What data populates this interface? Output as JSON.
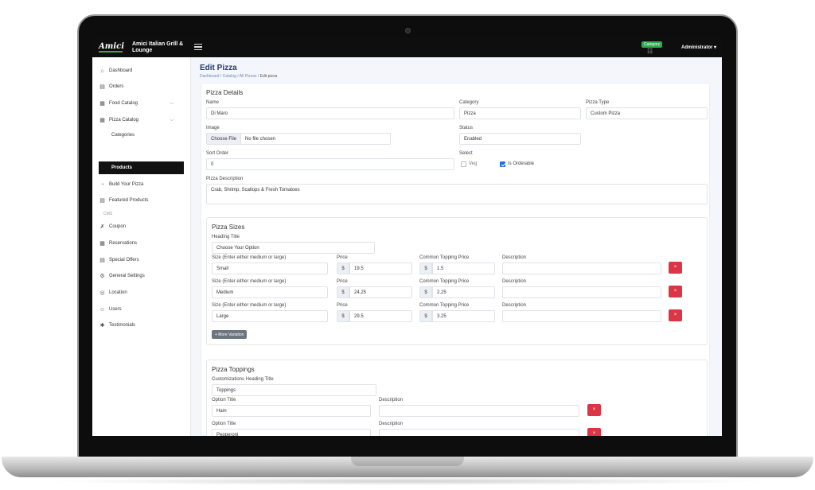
{
  "header": {
    "logo_text": "Amici",
    "brand_name_line1": "Amici Italian Grill &",
    "brand_name_line2": "Lounge",
    "category_badge": "Category",
    "user_menu": "Administrator ▾"
  },
  "sidebar": {
    "items": [
      {
        "label": "Dashboard",
        "icon": "⌂"
      },
      {
        "label": "Orders",
        "icon": "▤"
      },
      {
        "label": "Food Catalog",
        "icon": "▦"
      },
      {
        "label": "Pizza Catalog",
        "icon": "▦"
      },
      {
        "label": "Build Your Pizza",
        "icon": "◔"
      },
      {
        "label": "Featured Products",
        "icon": "▤"
      },
      {
        "label": "Coupon",
        "icon": "✗"
      },
      {
        "label": "Reservations",
        "icon": "▦"
      },
      {
        "label": "Special Offers",
        "icon": "▤"
      },
      {
        "label": "General Settings",
        "icon": "⚙"
      },
      {
        "label": "Location",
        "icon": "◎"
      },
      {
        "label": "Users",
        "icon": "☺"
      },
      {
        "label": "Testimonials",
        "icon": "✱"
      }
    ],
    "sub_items": {
      "categories": "Categories",
      "products": "Products"
    },
    "section_cms": "CMS"
  },
  "page": {
    "title": "Edit Pizza",
    "breadcrumb": [
      "Dashboard",
      "Catalog",
      "All Pizzas",
      "Edit pizza"
    ],
    "separator": "/"
  },
  "details": {
    "heading": "Pizza Details",
    "name_label": "Name",
    "name_value": "Di Maro",
    "category_label": "Category",
    "category_value": "Pizza",
    "type_label": "Pizza Type",
    "type_value": "Custom Pizza",
    "image_label": "Image",
    "choose_file": "Choose File",
    "no_file": "No file chosen",
    "status_label": "Status",
    "status_value": "Enabled",
    "sort_label": "Sort Order",
    "sort_value": "0",
    "select_label": "Select",
    "veg_label": "Veg",
    "veg_checked": false,
    "orderable_label": "Is Orderable",
    "orderable_checked": true,
    "desc_label": "Pizza Description",
    "desc_value": "Crab, Shrimp, Scallops & Fresh Tomatoes"
  },
  "sizes": {
    "heading": "Pizza Sizes",
    "heading_title_label": "Heading Title",
    "heading_title_value": "Choose Your Option",
    "size_label": "Size (Enter either medium or large)",
    "price_label": "Price",
    "topping_label": "Common Topping Price",
    "desc_label": "Description",
    "currency": "$",
    "delete_icon": "×",
    "rows": [
      {
        "size": "Small",
        "price": "19.5",
        "topping": "1.5",
        "description": ""
      },
      {
        "size": "Medium",
        "price": "24.25",
        "topping": "2.25",
        "description": ""
      },
      {
        "size": "Large",
        "price": "29.5",
        "topping": "3.25",
        "description": ""
      }
    ],
    "more_button": "+ More Variation"
  },
  "toppings": {
    "heading": "Pizza Toppings",
    "custom_heading_label": "Customizations Heading Title",
    "custom_heading_value": "Toppings",
    "option_label": "Option Title",
    "desc_label": "Description",
    "rows": [
      {
        "option": "Ham",
        "description": ""
      },
      {
        "option": "Pepperoni",
        "description": ""
      }
    ]
  }
}
